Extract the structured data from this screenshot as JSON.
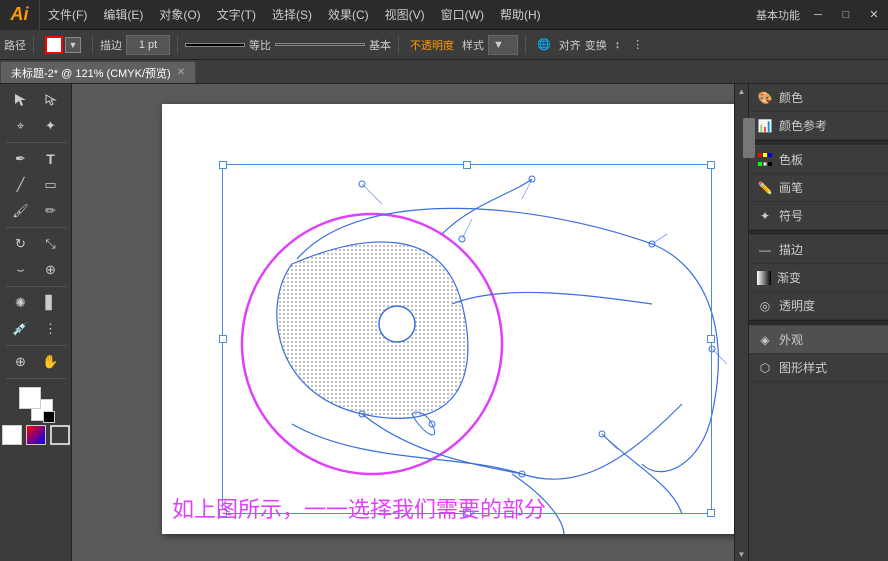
{
  "app": {
    "logo": "Ai",
    "workspace_label": "基本功能",
    "window_title": "未标题-2* @ 121% (CMYK/预览)"
  },
  "menu": {
    "items": [
      "文件(F)",
      "编辑(E)",
      "对象(O)",
      "文字(T)",
      "选择(S)",
      "效果(C)",
      "视图(V)",
      "窗口(W)",
      "帮助(H)"
    ]
  },
  "toolbar": {
    "stroke_label": "描边",
    "size_label": "1 pt",
    "ratio_label": "等比",
    "base_label": "基本",
    "opacity_label": "不透明度",
    "style_label": "样式",
    "align_label": "对齐",
    "transform_label": "变换",
    "path_label": "路径"
  },
  "tab": {
    "title": "未标题-2* @ 121% (CMYK/预览)"
  },
  "right_panel": {
    "items": [
      {
        "icon": "🎨",
        "label": "颜色"
      },
      {
        "icon": "📊",
        "label": "颜色参考"
      },
      {
        "icon": "▦",
        "label": "色板"
      },
      {
        "icon": "✏️",
        "label": "画笔"
      },
      {
        "icon": "✦",
        "label": "符号"
      },
      {
        "icon": "—",
        "label": "描边"
      },
      {
        "icon": "▓",
        "label": "渐变"
      },
      {
        "icon": "◎",
        "label": "透明度"
      },
      {
        "icon": "◈",
        "label": "外观"
      },
      {
        "icon": "⬡",
        "label": "图形样式"
      }
    ]
  },
  "canvas": {
    "text": "如上图所示，一一选择我们需要的部分"
  },
  "window_controls": {
    "minimize": "─",
    "maximize": "□",
    "close": "✕"
  }
}
